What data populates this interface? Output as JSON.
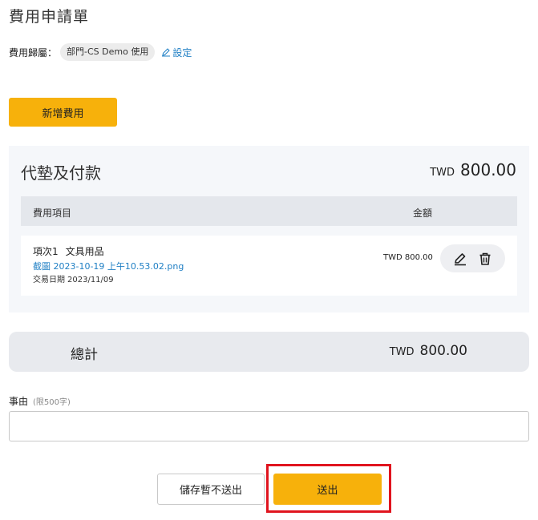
{
  "page": {
    "title": "費用申請單"
  },
  "owner": {
    "label": "費用歸屬：",
    "department": "部門-CS Demo 使用",
    "setting_link": "設定"
  },
  "toolbar": {
    "add_label": "新增費用"
  },
  "advance_section": {
    "title": "代墊及付款",
    "currency": "TWD",
    "total": "800.00",
    "columns": {
      "item": "費用項目",
      "amount": "金額"
    },
    "items": [
      {
        "index_label": "項次1",
        "name": "文具用品",
        "attachment": "截圖 2023-10-19 上午10.53.02.png",
        "date_label": "交易日期",
        "date": "2023/11/09",
        "amount": "TWD 800.00"
      }
    ]
  },
  "summary": {
    "label": "總計",
    "currency": "TWD",
    "amount": "800.00"
  },
  "reason": {
    "label": "事由",
    "hint": "(限500字)",
    "value": "",
    "placeholder": ""
  },
  "actions": {
    "save_label": "儲存暫不送出",
    "submit_label": "送出"
  },
  "colors": {
    "accent": "#f7b10b",
    "link": "#1f7fc4",
    "highlight": "#e0141e",
    "panel_bg": "#f5f7fa",
    "header_bg": "#e4e7ec"
  },
  "icons": {
    "setting": "pencil-icon",
    "edit": "edit-icon",
    "delete": "trash-icon"
  }
}
